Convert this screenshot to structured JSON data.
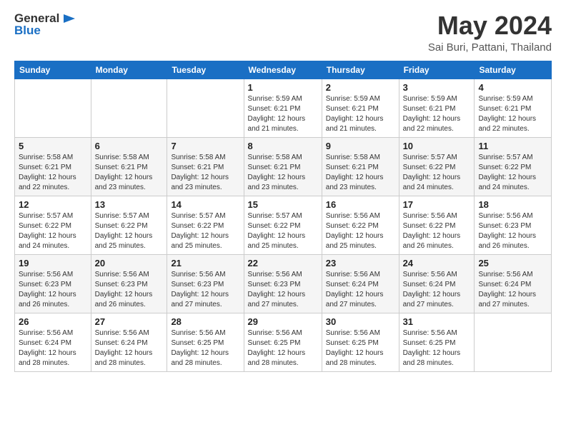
{
  "header": {
    "logo_line1": "General",
    "logo_line2": "Blue",
    "month": "May 2024",
    "location": "Sai Buri, Pattani, Thailand"
  },
  "weekdays": [
    "Sunday",
    "Monday",
    "Tuesday",
    "Wednesday",
    "Thursday",
    "Friday",
    "Saturday"
  ],
  "weeks": [
    [
      {
        "day": "",
        "sunrise": "",
        "sunset": "",
        "daylight": ""
      },
      {
        "day": "",
        "sunrise": "",
        "sunset": "",
        "daylight": ""
      },
      {
        "day": "",
        "sunrise": "",
        "sunset": "",
        "daylight": ""
      },
      {
        "day": "1",
        "sunrise": "Sunrise: 5:59 AM",
        "sunset": "Sunset: 6:21 PM",
        "daylight": "Daylight: 12 hours and 21 minutes."
      },
      {
        "day": "2",
        "sunrise": "Sunrise: 5:59 AM",
        "sunset": "Sunset: 6:21 PM",
        "daylight": "Daylight: 12 hours and 21 minutes."
      },
      {
        "day": "3",
        "sunrise": "Sunrise: 5:59 AM",
        "sunset": "Sunset: 6:21 PM",
        "daylight": "Daylight: 12 hours and 22 minutes."
      },
      {
        "day": "4",
        "sunrise": "Sunrise: 5:59 AM",
        "sunset": "Sunset: 6:21 PM",
        "daylight": "Daylight: 12 hours and 22 minutes."
      }
    ],
    [
      {
        "day": "5",
        "sunrise": "Sunrise: 5:58 AM",
        "sunset": "Sunset: 6:21 PM",
        "daylight": "Daylight: 12 hours and 22 minutes."
      },
      {
        "day": "6",
        "sunrise": "Sunrise: 5:58 AM",
        "sunset": "Sunset: 6:21 PM",
        "daylight": "Daylight: 12 hours and 23 minutes."
      },
      {
        "day": "7",
        "sunrise": "Sunrise: 5:58 AM",
        "sunset": "Sunset: 6:21 PM",
        "daylight": "Daylight: 12 hours and 23 minutes."
      },
      {
        "day": "8",
        "sunrise": "Sunrise: 5:58 AM",
        "sunset": "Sunset: 6:21 PM",
        "daylight": "Daylight: 12 hours and 23 minutes."
      },
      {
        "day": "9",
        "sunrise": "Sunrise: 5:58 AM",
        "sunset": "Sunset: 6:21 PM",
        "daylight": "Daylight: 12 hours and 23 minutes."
      },
      {
        "day": "10",
        "sunrise": "Sunrise: 5:57 AM",
        "sunset": "Sunset: 6:22 PM",
        "daylight": "Daylight: 12 hours and 24 minutes."
      },
      {
        "day": "11",
        "sunrise": "Sunrise: 5:57 AM",
        "sunset": "Sunset: 6:22 PM",
        "daylight": "Daylight: 12 hours and 24 minutes."
      }
    ],
    [
      {
        "day": "12",
        "sunrise": "Sunrise: 5:57 AM",
        "sunset": "Sunset: 6:22 PM",
        "daylight": "Daylight: 12 hours and 24 minutes."
      },
      {
        "day": "13",
        "sunrise": "Sunrise: 5:57 AM",
        "sunset": "Sunset: 6:22 PM",
        "daylight": "Daylight: 12 hours and 25 minutes."
      },
      {
        "day": "14",
        "sunrise": "Sunrise: 5:57 AM",
        "sunset": "Sunset: 6:22 PM",
        "daylight": "Daylight: 12 hours and 25 minutes."
      },
      {
        "day": "15",
        "sunrise": "Sunrise: 5:57 AM",
        "sunset": "Sunset: 6:22 PM",
        "daylight": "Daylight: 12 hours and 25 minutes."
      },
      {
        "day": "16",
        "sunrise": "Sunrise: 5:56 AM",
        "sunset": "Sunset: 6:22 PM",
        "daylight": "Daylight: 12 hours and 25 minutes."
      },
      {
        "day": "17",
        "sunrise": "Sunrise: 5:56 AM",
        "sunset": "Sunset: 6:22 PM",
        "daylight": "Daylight: 12 hours and 26 minutes."
      },
      {
        "day": "18",
        "sunrise": "Sunrise: 5:56 AM",
        "sunset": "Sunset: 6:23 PM",
        "daylight": "Daylight: 12 hours and 26 minutes."
      }
    ],
    [
      {
        "day": "19",
        "sunrise": "Sunrise: 5:56 AM",
        "sunset": "Sunset: 6:23 PM",
        "daylight": "Daylight: 12 hours and 26 minutes."
      },
      {
        "day": "20",
        "sunrise": "Sunrise: 5:56 AM",
        "sunset": "Sunset: 6:23 PM",
        "daylight": "Daylight: 12 hours and 26 minutes."
      },
      {
        "day": "21",
        "sunrise": "Sunrise: 5:56 AM",
        "sunset": "Sunset: 6:23 PM",
        "daylight": "Daylight: 12 hours and 27 minutes."
      },
      {
        "day": "22",
        "sunrise": "Sunrise: 5:56 AM",
        "sunset": "Sunset: 6:23 PM",
        "daylight": "Daylight: 12 hours and 27 minutes."
      },
      {
        "day": "23",
        "sunrise": "Sunrise: 5:56 AM",
        "sunset": "Sunset: 6:24 PM",
        "daylight": "Daylight: 12 hours and 27 minutes."
      },
      {
        "day": "24",
        "sunrise": "Sunrise: 5:56 AM",
        "sunset": "Sunset: 6:24 PM",
        "daylight": "Daylight: 12 hours and 27 minutes."
      },
      {
        "day": "25",
        "sunrise": "Sunrise: 5:56 AM",
        "sunset": "Sunset: 6:24 PM",
        "daylight": "Daylight: 12 hours and 27 minutes."
      }
    ],
    [
      {
        "day": "26",
        "sunrise": "Sunrise: 5:56 AM",
        "sunset": "Sunset: 6:24 PM",
        "daylight": "Daylight: 12 hours and 28 minutes."
      },
      {
        "day": "27",
        "sunrise": "Sunrise: 5:56 AM",
        "sunset": "Sunset: 6:24 PM",
        "daylight": "Daylight: 12 hours and 28 minutes."
      },
      {
        "day": "28",
        "sunrise": "Sunrise: 5:56 AM",
        "sunset": "Sunset: 6:25 PM",
        "daylight": "Daylight: 12 hours and 28 minutes."
      },
      {
        "day": "29",
        "sunrise": "Sunrise: 5:56 AM",
        "sunset": "Sunset: 6:25 PM",
        "daylight": "Daylight: 12 hours and 28 minutes."
      },
      {
        "day": "30",
        "sunrise": "Sunrise: 5:56 AM",
        "sunset": "Sunset: 6:25 PM",
        "daylight": "Daylight: 12 hours and 28 minutes."
      },
      {
        "day": "31",
        "sunrise": "Sunrise: 5:56 AM",
        "sunset": "Sunset: 6:25 PM",
        "daylight": "Daylight: 12 hours and 28 minutes."
      },
      {
        "day": "",
        "sunrise": "",
        "sunset": "",
        "daylight": ""
      }
    ]
  ]
}
